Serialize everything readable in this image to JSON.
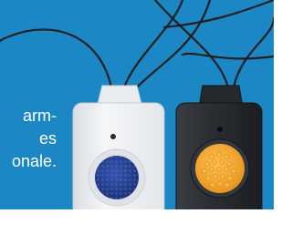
{
  "caption": {
    "lines": [
      "arm-",
      "es",
      "onale."
    ]
  },
  "colors": {
    "background": "#1c87c5",
    "white_pendant": "#eef0f2",
    "black_pendant": "#2a2d31",
    "blue_button": "#233e8c",
    "yellow_button": "#f2a531",
    "cord": "#1f1f1f"
  },
  "icons": {
    "white_pendant": "emergency-pendant-white",
    "black_pendant": "emergency-pendant-black"
  }
}
